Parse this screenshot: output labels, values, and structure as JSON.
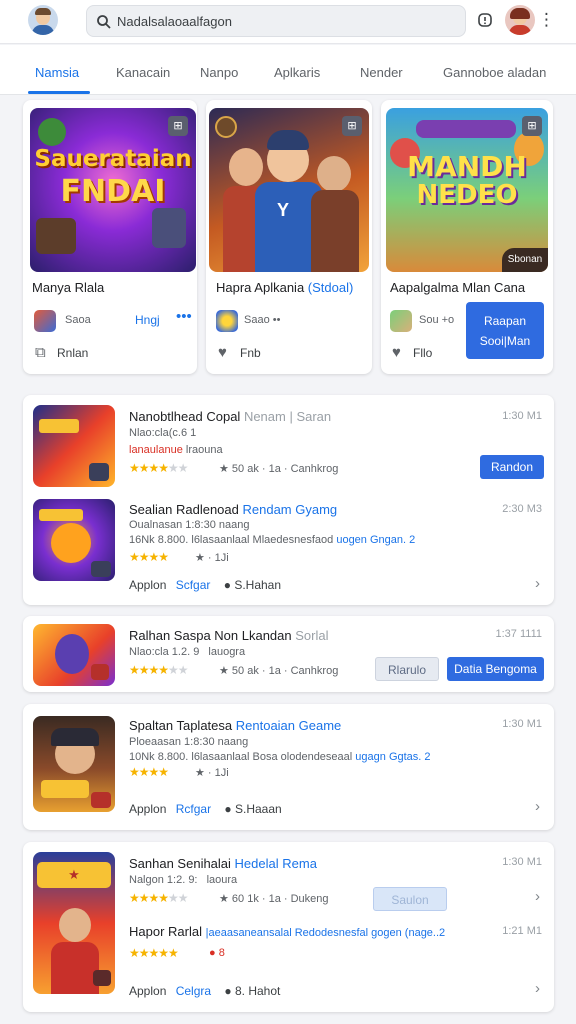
{
  "header": {
    "search_text": "Nadalsalaoaalfagon"
  },
  "tabs": [
    "Namsia",
    "Kanacain",
    "Nanpo",
    "Aplkaris",
    "Nender",
    "Gannoboe aladan"
  ],
  "featured": [
    {
      "art_title": [
        "Sauerataian",
        "FNDAI"
      ],
      "title": "Manya Rlala",
      "sub": "Saoa",
      "link": "Hngj",
      "dots": "•••",
      "heart_label": "Rnlan"
    },
    {
      "art_title": [],
      "title": "Hapra Aplkania",
      "title_accent": "(Stdoal)",
      "sub": "Saao ••",
      "heart_label": "Fnb"
    },
    {
      "art_title": [
        "MANDH",
        "NEDEO"
      ],
      "badge": "Sbonan",
      "title": "Aapalgalma Mlan Cana",
      "sub": "Sou +o",
      "heart_label": "Fllo",
      "button": [
        "Raapan",
        "Sooi|Man"
      ]
    }
  ],
  "list1": {
    "row1": {
      "title": "Nanobtlhead Copal",
      "title_muted": "Nenam | Saran",
      "time": "1:30 M1",
      "meta": "Nlao:cla(c.6 1",
      "meta_red": "lanaulanue",
      "meta_tail": "lraouna",
      "stars": "★★★★",
      "stars_dim": "★★",
      "rating": "★ 50 ak · 1a · Canhkrog",
      "button": "Randon"
    },
    "row2": {
      "title": "Sealian Radlenoad",
      "title_accent": "Rendam Gyamg",
      "time": "2:30 M3",
      "meta": "Oualnasan 1:8:30 naang",
      "meta2": "16Nk 8.800. l6lasaanlaal Mlaedesnesfaod",
      "meta2_accent": "uogen Gngan. 2",
      "stars": "★★★★",
      "rating_tail": "★ · 1Ji",
      "foot": "Applon",
      "foot_accent": "Scfgar",
      "foot_tail": "● S.Hahan"
    }
  },
  "list2": {
    "row": {
      "title": "Ralhan Saspa Non Lkandan",
      "title_muted": "Sorlal",
      "time": "1:37 1111",
      "meta": "Nlao:cla 1.2. 9",
      "meta_tail": "lauogra",
      "stars": "★★★★",
      "stars_dim": "★★",
      "rating": "★ 50 ak · 1a · Canhkrog",
      "button_ghost": "Rlarulo",
      "button": "Datia Bengoma"
    }
  },
  "list3": {
    "row": {
      "title": "Spaltan Taplatesa",
      "title_accent": "Rentoaian Geame",
      "time": "1:30 M1",
      "meta": "Ploeaasan 1:8:30 naang",
      "meta2": "10Nk 8.800. l6lasaanlaal Bosa olodendeseaal",
      "meta2_accent": "ugagn Ggtas. 2",
      "stars": "★★★★",
      "rating_tail": "★ · 1Ji",
      "foot": "Applon",
      "foot_accent": "Rcfgar",
      "foot_tail": "● S.Haaan"
    }
  },
  "list4": {
    "row1": {
      "title": "Sanhan Senihalai",
      "title_accent": "Hedelal Rema",
      "time": "1:30 M1",
      "meta": "Nalgon 1:2. 9:",
      "meta_tail": "laoura",
      "stars": "★★★★",
      "stars_dim": "★★",
      "rating": "★ 60 1k · 1a · Dukeng",
      "button": "Saulon"
    },
    "row2": {
      "title": "Hapor Rarlal",
      "title_accent": "|aeaasaneansalal Redodesnesfal gogen (nage..2",
      "time": "1:21 M1",
      "stars": "★★★★★",
      "rating_tail": "● 8",
      "foot": "Applon",
      "foot_accent": "Celgra",
      "foot_tail": "● 8. Hahot"
    }
  },
  "colors": {
    "accent": "#1a73e8",
    "button": "#2f6be0",
    "star": "#f6b300"
  }
}
